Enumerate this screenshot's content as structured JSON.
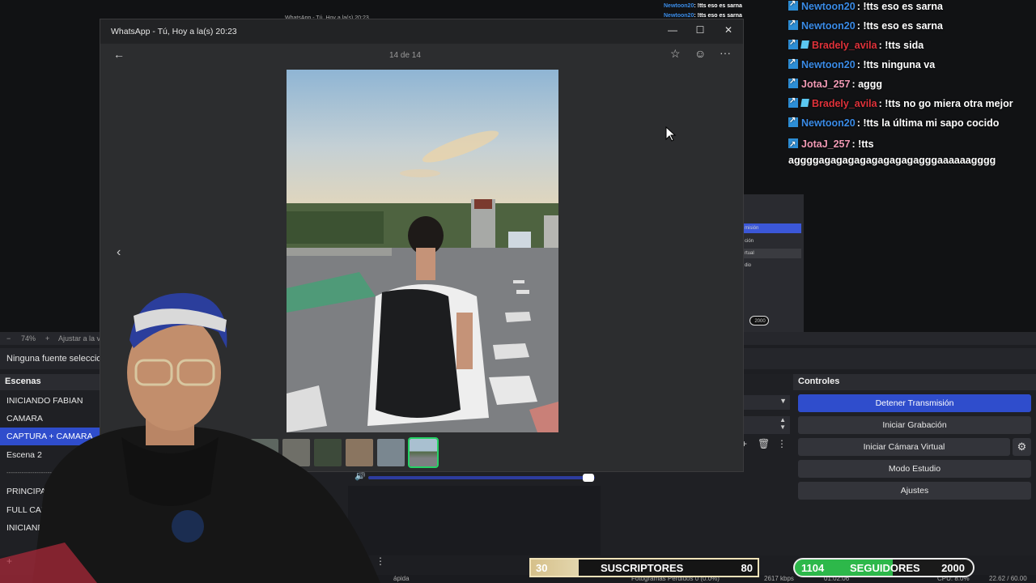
{
  "chat": {
    "messages": [
      {
        "user": "Newtoon20",
        "user_color": "#3a8be6",
        "text": ": !tts eso es sarna",
        "badge2": false
      },
      {
        "user": "Newtoon20",
        "user_color": "#3a8be6",
        "text": ": !tts eso es sarna",
        "badge2": false
      },
      {
        "user": "Bradely_avila",
        "user_color": "#e0323a",
        "text": ": !tts sida",
        "badge2": true
      },
      {
        "user": "Newtoon20",
        "user_color": "#3a8be6",
        "text": ": !tts ninguna va",
        "badge2": false
      },
      {
        "user": "JotaJ_257",
        "user_color": "#f19ab5",
        "text": ": aggg",
        "badge2": false
      },
      {
        "user": "Bradely_avila",
        "user_color": "#e0323a",
        "text": ": !tts no go miera otra mejor",
        "badge2": true
      },
      {
        "user": "Newtoon20",
        "user_color": "#3a8be6",
        "text": ": !tts la última mi sapo cocido",
        "badge2": false
      },
      {
        "user": "JotaJ_257",
        "user_color": "#f19ab5",
        "text": ": !tts aggggagagagagagagagagagggaaaaaagggg",
        "badge2": false
      }
    ],
    "mini": [
      {
        "user": "Newtoon20",
        "text": ": !tts eso es sarna"
      },
      {
        "user": "Newtoon20",
        "text": ": !tts eso es sarna"
      }
    ]
  },
  "whatsapp": {
    "title": "WhatsApp - Tú, Hoy a la(s) 20:23",
    "counter": "14 de 14",
    "icons": {
      "back": "arrow-left-icon",
      "star": "star-icon",
      "react": "emoji-icon",
      "more": "more-icon",
      "prev": "chevron-left-icon"
    }
  },
  "obs": {
    "zoom": {
      "minus": "−",
      "value": "74%",
      "plus": "+",
      "fit": "Ajustar a la ve"
    },
    "source_none": "Ninguna fuente selecciona",
    "scenes_header": "Escenas",
    "scenes": [
      "INICIANDO FABIAN",
      "CAMARA",
      "CAPTURA + CAMARA",
      "Escena 2",
      "------------------------",
      "PRINCIPAL AR",
      "FULL CAM",
      "INICIAND"
    ],
    "selected_scene_index": 2,
    "controls_header": "Controles",
    "controls": {
      "stop_stream": "Detener Transmisión",
      "start_recording": "Iniciar Grabación",
      "start_virtual_cam": "Iniciar Cámara Virtual",
      "studio_mode": "Modo Estudio",
      "settings": "Ajustes"
    },
    "mini_preview": {
      "row1": "misión",
      "row2": "ción",
      "row3": "rtual",
      "row4": "dio",
      "bitrate": "2000"
    },
    "status": {
      "dropped": "Fotogramas Perdidos 0 (0.0%)",
      "kbps": "2617 kbps",
      "time": "01:02:06",
      "cpu": "CPU: 8.0%",
      "fps": "22.62 / 60.00 FPS",
      "rapida": "ápida"
    }
  },
  "goals": {
    "subs": {
      "current": "30",
      "label": "SUSCRIPTORES",
      "target": "80",
      "progress": 0.375
    },
    "followers": {
      "current": "1104",
      "label": "SEGUIDORES",
      "target": "2000",
      "progress": 0.552
    }
  }
}
